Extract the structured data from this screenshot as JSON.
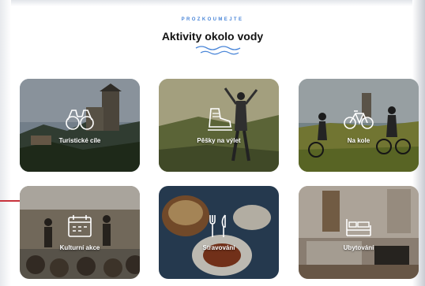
{
  "section": {
    "eyebrow": "PROZKOUMEJTE",
    "title": "Aktivity okolo vody",
    "accent_color": "#4a86d8"
  },
  "cards": [
    {
      "label": "Turistické cíle",
      "icon": "binoculars-icon"
    },
    {
      "label": "Pěšky na výlet",
      "icon": "hiking-boot-icon"
    },
    {
      "label": "Na kole",
      "icon": "bicycle-icon"
    },
    {
      "label": "Kulturní akce",
      "icon": "calendar-icon"
    },
    {
      "label": "Stravování",
      "icon": "cutlery-icon"
    },
    {
      "label": "Ubytování",
      "icon": "bed-icon"
    }
  ]
}
